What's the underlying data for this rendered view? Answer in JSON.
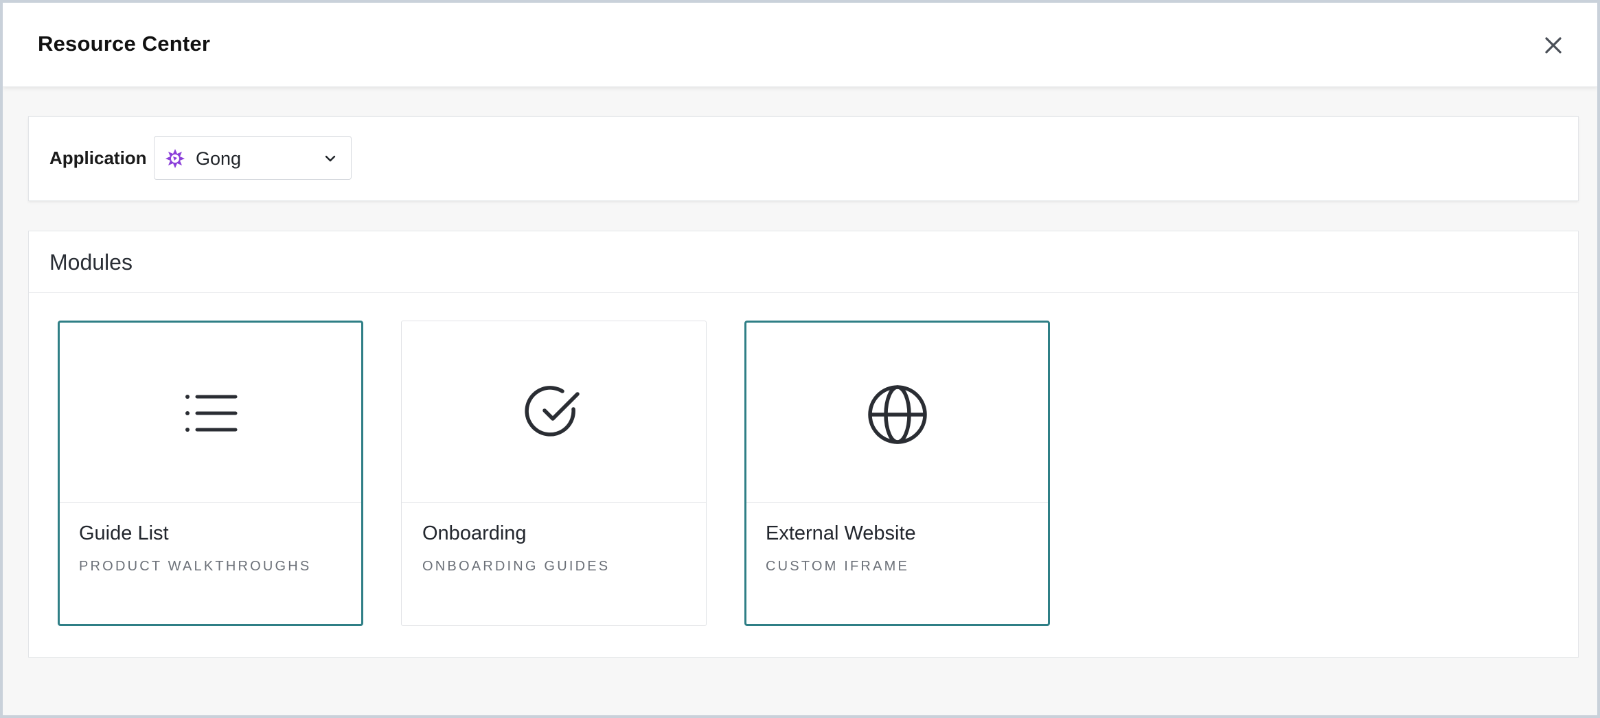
{
  "header": {
    "title": "Resource Center",
    "close_icon": "close-icon"
  },
  "application": {
    "label": "Application",
    "selected": "Gong",
    "logo_icon": "gong-logo-icon",
    "logo_color": "#8b3fd9"
  },
  "modules": {
    "title": "Modules",
    "accent_color": "#2f7f86",
    "items": [
      {
        "title": "Guide List",
        "subtitle": "PRODUCT WALKTHROUGHS",
        "icon": "list-icon",
        "selected": true
      },
      {
        "title": "Onboarding",
        "subtitle": "ONBOARDING GUIDES",
        "icon": "check-circle-icon",
        "selected": false
      },
      {
        "title": "External Website",
        "subtitle": "CUSTOM IFRAME",
        "icon": "globe-icon",
        "selected": true
      }
    ]
  }
}
